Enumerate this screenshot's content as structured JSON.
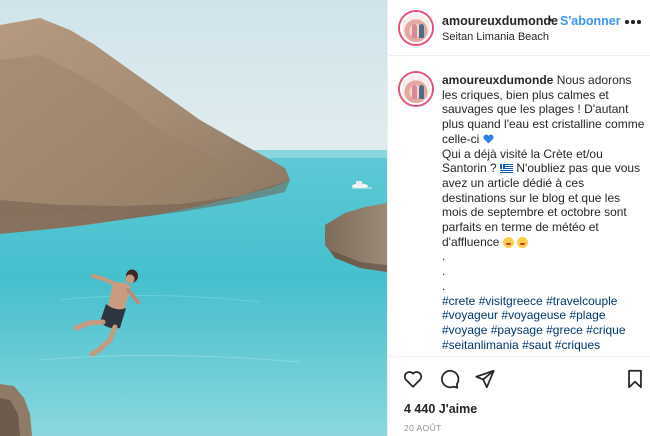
{
  "photo": {
    "alt_semantic": "cliff-jump-into-turquoise-cove"
  },
  "header": {
    "username": "amoureuxdumonde",
    "separator": "•",
    "follow_label": "S'abonner",
    "location": "Seitan Limania Beach",
    "more_icon": "more-options-icon"
  },
  "caption": {
    "username": "amoureuxdumonde",
    "line1": "Nous adorons les criques, bien plus calmes et sauvages que les plages ! D'autant plus quand l'eau est cristalline comme celle-ci",
    "line2": "Qui a déjà visité la Crète et/ou Santorin ?",
    "line3": "N'oubliez pas que vous avez un article dédié à ces destinations sur le blog et que les mois de septembre et octobre sont parfaits en terme de météo et d'affluence",
    "dots": [
      ".",
      ".",
      "."
    ],
    "hashtags": [
      "#crete",
      "#visitgreece",
      "#travelcouple",
      "#voyageur",
      "#voyageuse",
      "#plage",
      "#voyage",
      "#paysage",
      "#grece",
      "#crique",
      "#seitanlimania",
      "#saut",
      "#criques"
    ]
  },
  "actions": {
    "icons": [
      "heart-icon",
      "comment-icon",
      "share-icon",
      "bookmark-icon"
    ],
    "likes_count": "4 440",
    "likes_label": "J'aime",
    "date": "20 AOÛT"
  },
  "colors": {
    "link": "#3897f0",
    "hashtag": "#00376b",
    "text": "#262626",
    "muted": "#8e8e8e",
    "sea": "#4cc3d1"
  }
}
